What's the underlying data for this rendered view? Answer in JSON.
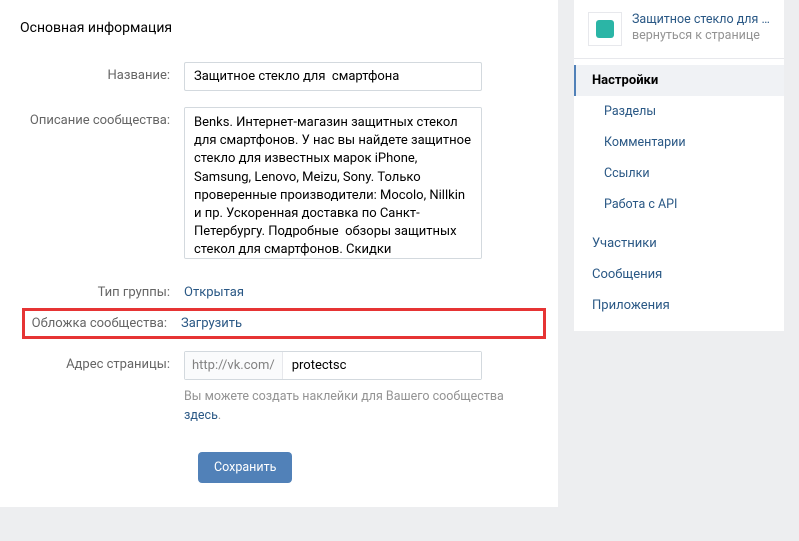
{
  "main": {
    "title": "Основная информация",
    "fields": {
      "name_label": "Название:",
      "name_value": "Защитное стекло для  смартфона",
      "description_label": "Описание сообщества:",
      "description_value": "Benks. Интернет-магазин защитных стекол для смартфонов. У нас вы найдете защитное стекло для известных марок iPhone, Samsung, Lenovo, Meizu, Sony. Только проверенные производители: Mocolo, Nillkin и пр. Ускоренная доставка по Санкт-Петербургу. Подробные  обзоры защитных стекол для смартфонов. Скидки покупателям через группу Вконтакте.",
      "group_type_label": "Тип группы:",
      "group_type_value": "Открытая",
      "cover_label": "Обложка сообщества:",
      "cover_value": "Загрузить",
      "address_label": "Адрес страницы:",
      "address_prefix": "http://vk.com/",
      "address_value": "protectsc",
      "sticker_note_prefix": "Вы можете создать наклейки для Вашего сообщества ",
      "sticker_note_link": "здесь"
    },
    "save_button": "Сохранить"
  },
  "sidebar": {
    "header": {
      "title": "Защитное стекло для см…",
      "subtitle": "вернуться к странице"
    },
    "items": [
      {
        "label": "Настройки",
        "active": true,
        "sub": false
      },
      {
        "label": "Разделы",
        "active": false,
        "sub": true
      },
      {
        "label": "Комментарии",
        "active": false,
        "sub": true
      },
      {
        "label": "Ссылки",
        "active": false,
        "sub": true
      },
      {
        "label": "Работа с API",
        "active": false,
        "sub": true
      },
      {
        "label": "Участники",
        "active": false,
        "sub": false
      },
      {
        "label": "Сообщения",
        "active": false,
        "sub": false
      },
      {
        "label": "Приложения",
        "active": false,
        "sub": false
      }
    ]
  }
}
